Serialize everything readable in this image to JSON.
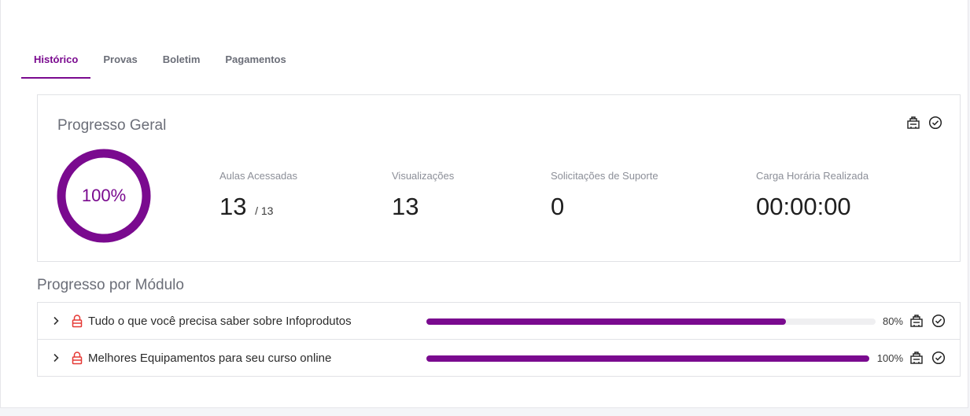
{
  "tabs": [
    {
      "label": "Histórico",
      "active": true
    },
    {
      "label": "Provas",
      "active": false
    },
    {
      "label": "Boletim",
      "active": false
    },
    {
      "label": "Pagamentos",
      "active": false
    }
  ],
  "progress": {
    "title": "Progresso Geral",
    "overall_percent": "100%",
    "overall_value": 1.0,
    "stats": [
      {
        "label": "Aulas Acessadas",
        "value": "13",
        "sub": "/ 13"
      },
      {
        "label": "Visualizações",
        "value": "13"
      },
      {
        "label": "Solicitações de Suporte",
        "value": "0"
      },
      {
        "label": "Carga Horária Realizada",
        "value": "00:00:00"
      }
    ],
    "icons": [
      "certificate-icon",
      "check-circle-icon"
    ]
  },
  "modules_section": {
    "title": "Progresso por Módulo",
    "items": [
      {
        "title": "Tudo o que você precisa saber sobre Infoprodutos",
        "percent": "80%",
        "value": 0.8,
        "locked": true
      },
      {
        "title": "Melhores Equipamentos para seu curso online",
        "percent": "100%",
        "value": 1.0,
        "locked": true
      }
    ]
  },
  "colors": {
    "accent": "#7a0a8f",
    "lock": "#e53935",
    "track": "#efeff1",
    "muted_text": "#6b6e78"
  }
}
